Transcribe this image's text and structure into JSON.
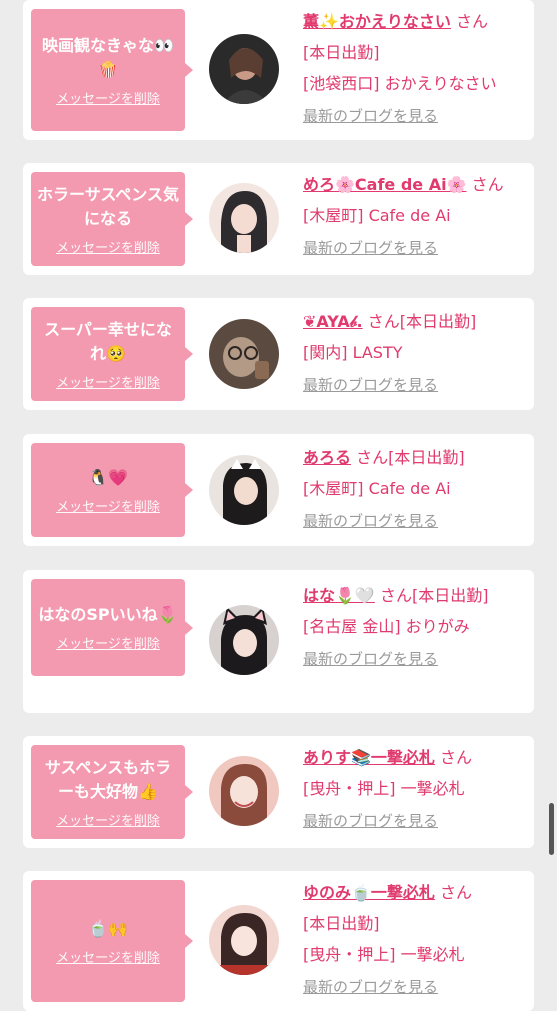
{
  "labels": {
    "delete": "メッセージを削除",
    "blog": "最新のブログを見る",
    "san": "さん"
  },
  "cards": [
    {
      "msg": "映画観なきゃな👀🍿",
      "name": "薫✨おかえりなさい",
      "line2": "[本日出勤]",
      "line3": "[池袋西口] おかえりなさい",
      "avatar_colors": [
        "#2a2a2a",
        "#b28a78",
        "#3b3b3b"
      ]
    },
    {
      "msg": "ホラーサスペンス気になる",
      "name": "めろ🌸Cafe de Ai🌸",
      "line2": "[木屋町] Cafe de Ai",
      "line3": "",
      "avatar_colors": [
        "#f3e6e0",
        "#c9a99c",
        "#2d2b2e"
      ]
    },
    {
      "msg": "スーパー幸せになれ🥺",
      "name": "❦AYA𝒷.",
      "line2": "[本日出勤]",
      "line3": "[関内] LASTY",
      "avatar_colors": [
        "#5b4a40",
        "#b29a86",
        "#2c2522"
      ]
    },
    {
      "msg": "🐧💗",
      "name": "あろる",
      "line2": "[本日出勤]",
      "line3": "[木屋町] Cafe de Ai",
      "avatar_colors": [
        "#e9e4e0",
        "#1e1b1c",
        "#d8b9a8"
      ]
    },
    {
      "msg": "はなのSPいいね🌷",
      "name": "はな🌷🤍",
      "line2": "[本日出勤]",
      "line3": "[名古屋 金山] おりがみ",
      "avatar_colors": [
        "#d7d2d0",
        "#1c1a1c",
        "#e4c2b6"
      ]
    },
    {
      "msg": "サスペンスもホラーも大好物👍",
      "name": "ありす📚一撃必札",
      "line2": "[曳舟・押上] 一撃必札",
      "line3": "",
      "avatar_colors": [
        "#f0c8c0",
        "#8a4a3c",
        "#f7e2da"
      ]
    },
    {
      "msg": "🍵🙌",
      "name": "ゆのみ🍵一撃必札",
      "line2": "[本日出勤]",
      "line3": "[曳舟・押上] 一撃必札",
      "avatar_colors": [
        "#f2d6d0",
        "#b6342c",
        "#3a2624"
      ]
    }
  ]
}
